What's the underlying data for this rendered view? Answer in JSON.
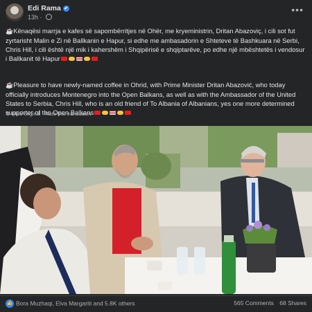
{
  "post": {
    "author": "Edi Rama",
    "verified": "✔",
    "time": "13h",
    "dot": "·",
    "more": "•••",
    "text_original": "Kënaqësi marrja e kafes së sapombërritjes në Ohër, me kryeministrin, Dritan Abazoviç, i cili sot fut zyrtarisht Malin e Zi në Ballkanin e Hapur, si edhe me ambasadorin e Shteteve të Bashkuara në Serbi, Chris Hill, i cili është një mik i kahershëm i Shqipërisë e shqiptarëve, po edhe një mbështetës i vendosur i Ballkanit të Hapur",
    "text_translated": "Pleasure to have newly-named coffee in Ohrid, with Prime Minister Dritan Abazović, who today officially introduces Montenegro into the Open Balkans, as well as with the Ambassador of the United States to Serbia, Chris Hill, who is an old friend of To Albania of Albanians, yes one more determined supporter of the Open Balkans",
    "cup_emoji": "☕",
    "hide_original": "Hide original",
    "link_sep": "·",
    "rate_translation": "Rate this translation"
  },
  "footer": {
    "reactions_text": "Bora Muzhaqi, Elva Margariti and 5.8K others",
    "like_icon": "👍",
    "comments": "565 Comments",
    "shares": "68 Shares"
  },
  "colors": {
    "background": "#242526",
    "text": "#e4e6eb",
    "secondary_text": "#b0b3b8",
    "accent": "#2d88ff"
  }
}
